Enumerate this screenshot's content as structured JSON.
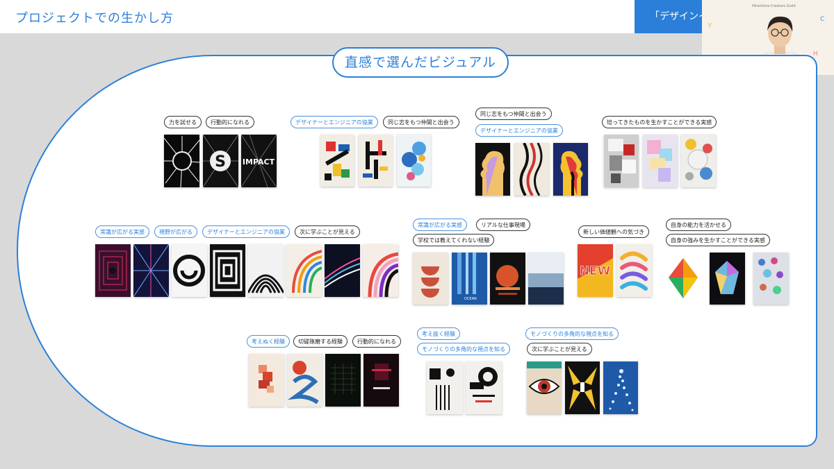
{
  "header": {
    "title": "プロジェクトでの生かし方",
    "tab_label": "「デザインイ"
  },
  "webcam": {
    "brand": "Hiroshima Creators Guild"
  },
  "board": {
    "heading": "直感で選んだビジュアル"
  },
  "tags": {
    "g1_a": "力を試せる",
    "g1_b": "行動的になれる",
    "g2_a": "デザイナーとエンジニアの協業",
    "g2_b": "同じ志をもつ仲間と出会う",
    "g3_a": "同じ志をもつ仲間と出会う",
    "g3_b": "デザイナーとエンジニアの協業",
    "g4_a": "培ってきたものを生かすことができる実感",
    "g5_a": "常識が広がる実感",
    "g5_b": "視野が広がる",
    "g5_c": "デザイナーとエンジニアの協業",
    "g5_d": "次に学ぶことが見える",
    "g6_a": "常識が広がる実感",
    "g6_b": "リアルな仕事現場",
    "g6_c": "学校では教えてくれない経験",
    "g7_a": "新しい価値観への気づき",
    "g8_a": "自身の能力を活かせる",
    "g8_b": "自身の強みを生かすことができる実感",
    "g9_a": "考えぬく経験",
    "g9_b": "切磋琢磨する経験",
    "g9_c": "行動的になれる",
    "g10_a": "考え抜く経験",
    "g10_b": "モノづくりの多角的な視点を知る",
    "g11_a": "モノづくりの多角的な視点を知る",
    "g11_b": "次に学ぶことが見える"
  },
  "poster_text": {
    "s": "S",
    "impact": "IMPACT",
    "new": "NEW",
    "ocean": "OCEAN"
  },
  "colors": {
    "accent": "#2b7fd9",
    "background": "#d9d9d9",
    "panel": "#ffffff"
  }
}
